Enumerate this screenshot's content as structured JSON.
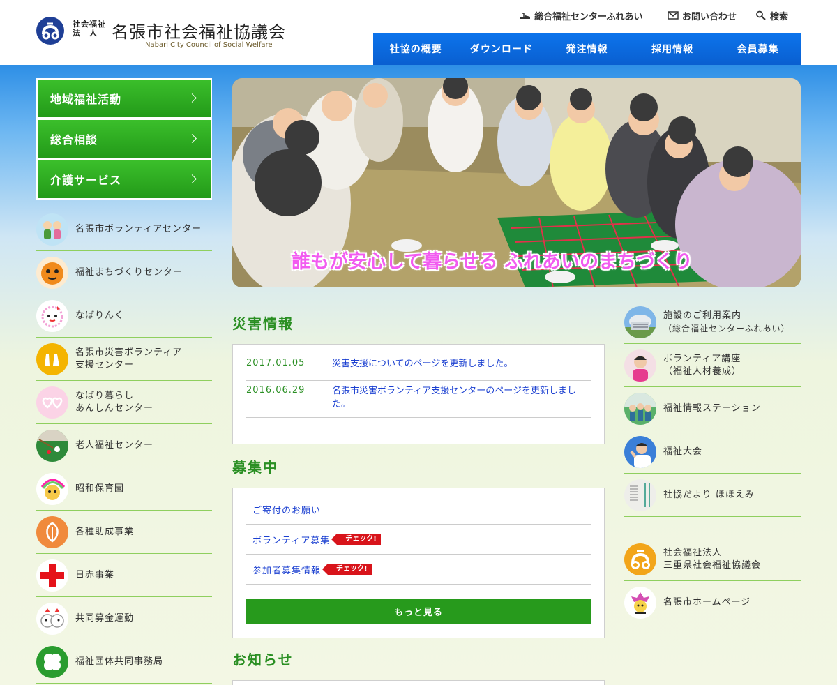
{
  "header": {
    "corp_type_line1": "社会福祉",
    "corp_type_line2": "法　人",
    "org_name": "名張市社会福祉協議会",
    "org_name_en": "Nabari City Council of Social Welfare",
    "util_links": [
      {
        "label": "総合福祉センターふれあい",
        "icon": "shoe-icon"
      },
      {
        "label": "お問い合わせ",
        "icon": "mail-icon"
      },
      {
        "label": "検索",
        "icon": "search-icon"
      }
    ],
    "nav": [
      "社協の概要",
      "ダウンロード",
      "発注情報",
      "採用情報",
      "会員募集"
    ]
  },
  "left_menu": [
    "地域福祉活動",
    "総合相談",
    "介護サービス"
  ],
  "left_links": [
    {
      "label": "名張市ボランティアセンター"
    },
    {
      "label": "福祉まちづくりセンター"
    },
    {
      "label": "なばりんく"
    },
    {
      "label": "名張市災害ボランティア",
      "label2": "支援センター"
    },
    {
      "label": "なばり暮らし",
      "label2": "あんしんセンター"
    },
    {
      "label": "老人福祉センター"
    },
    {
      "label": "昭和保育園"
    },
    {
      "label": "各種助成事業"
    },
    {
      "label": "日赤事業"
    },
    {
      "label": "共同募金運動"
    },
    {
      "label": "福祉団体共同事務局"
    }
  ],
  "hero": {
    "caption": "誰もが安心して暮らせる ふれあいのまちづくり"
  },
  "disaster": {
    "title": "災害情報",
    "items": [
      {
        "date": "2017.01.05",
        "text": "災害支援についてのページを更新しました。"
      },
      {
        "date": "2016.06.29",
        "text": "名張市災害ボランティア支援センターのページを更新しました。"
      }
    ]
  },
  "recruit": {
    "title": "募集中",
    "items": [
      {
        "text": "ご寄付のお願い",
        "badge": ""
      },
      {
        "text": "ボランティア募集",
        "badge": "チェック!"
      },
      {
        "text": "参加者募集情報",
        "badge": "チェック!"
      }
    ],
    "more_label": "もっと見る"
  },
  "notice": {
    "title": "お知らせ"
  },
  "right_links": [
    {
      "label": "施設のご利用案内",
      "sub": "（総合福祉センターふれあい）"
    },
    {
      "label": "ボランティア講座",
      "label2": "（福祉人材養成）"
    },
    {
      "label": "福祉情報ステーション"
    },
    {
      "label": "福祉大会"
    },
    {
      "label": "社協だより ほほえみ"
    }
  ],
  "right_links2": [
    {
      "label": "社会福祉法人",
      "label2": "三重県社会福祉協議会"
    },
    {
      "label": "名張市ホームページ"
    }
  ],
  "colors": {
    "nav_blue": "#0a68dc",
    "menu_green": "#2aa81f",
    "section_green": "#2a8f23",
    "link_blue": "#1a3fd1",
    "badge_red": "#d8141b"
  }
}
